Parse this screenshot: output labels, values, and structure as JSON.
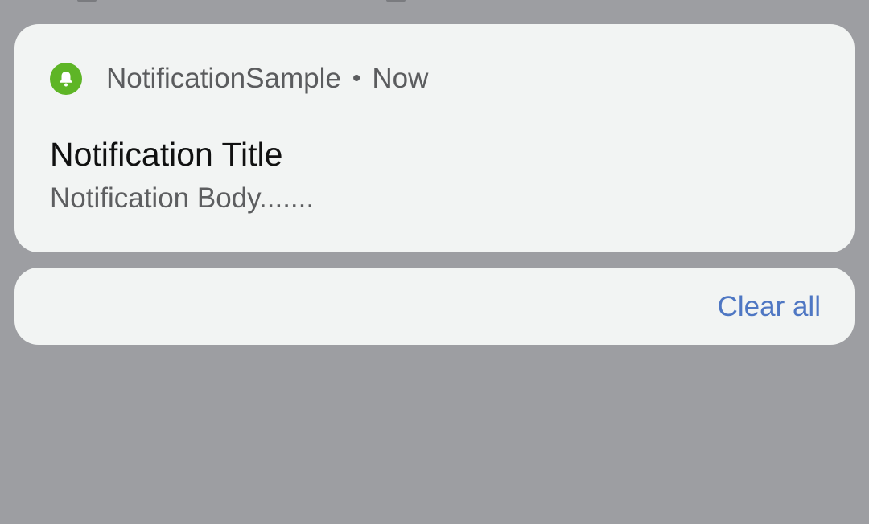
{
  "notification": {
    "app_icon": "bell-icon",
    "app_name": "NotificationSample",
    "separator": "•",
    "timestamp": "Now",
    "title": "Notification Title",
    "body": "Notification Body......."
  },
  "actions": {
    "clear_all_label": "Clear all"
  },
  "colors": {
    "background": "#9d9ea2",
    "card": "#f2f4f3",
    "app_icon": "#5eb526",
    "accent": "#4f77c3"
  }
}
